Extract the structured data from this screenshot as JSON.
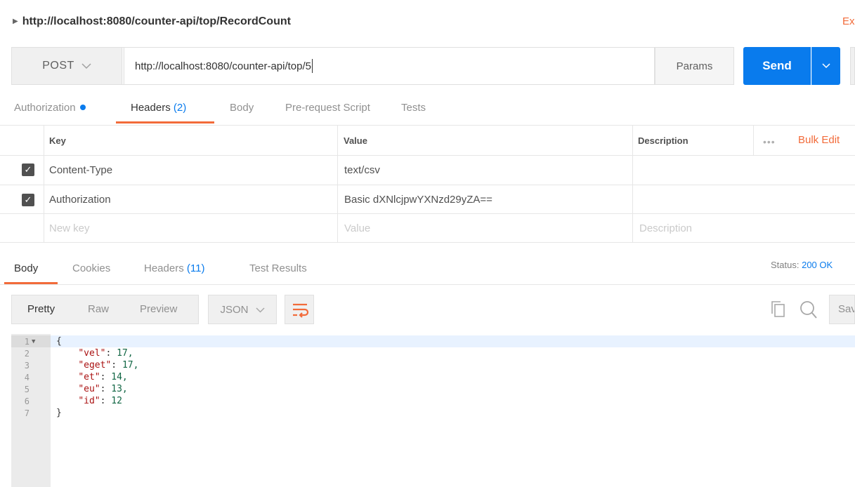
{
  "request": {
    "name": "http://localhost:8080/counter-api/top/RecordCount",
    "top_right_link": "Ex",
    "method": "POST",
    "url": "http://localhost:8080/counter-api/top/5",
    "params_label": "Params",
    "send_label": "Send",
    "extra_button": ""
  },
  "request_tabs": {
    "authorization": "Authorization",
    "headers": "Headers",
    "headers_count": "(2)",
    "body": "Body",
    "prerequest": "Pre-request Script",
    "tests": "Tests"
  },
  "headers_table": {
    "columns": {
      "key": "Key",
      "value": "Value",
      "description": "Description"
    },
    "bulk_edit": "Bulk Edit",
    "more": "•••",
    "rows": [
      {
        "key": "Content-Type",
        "value": "text/csv",
        "description": "",
        "checked": true
      },
      {
        "key": "Authorization",
        "value": "Basic dXNlcjpwYXNzd29yZA==",
        "description": "",
        "checked": true
      }
    ],
    "placeholders": {
      "key": "New key",
      "value": "Value",
      "description": "Description"
    }
  },
  "response": {
    "tabs": {
      "body": "Body",
      "cookies": "Cookies",
      "headers": "Headers",
      "headers_count": "(11)",
      "tests": "Test Results"
    },
    "status_label": "Status:",
    "status_value": "200 OK",
    "view_modes": {
      "pretty": "Pretty",
      "raw": "Raw",
      "preview": "Preview"
    },
    "format": "JSON",
    "save_label": "Save",
    "code_lines": [
      {
        "num": "1",
        "text": "{"
      },
      {
        "num": "2",
        "key": "\"vel\"",
        "val": "17,"
      },
      {
        "num": "3",
        "key": "\"eget\"",
        "val": "17,"
      },
      {
        "num": "4",
        "key": "\"et\"",
        "val": "14,"
      },
      {
        "num": "5",
        "key": "\"eu\"",
        "val": "13,"
      },
      {
        "num": "6",
        "key": "\"id\"",
        "val": "12"
      },
      {
        "num": "7",
        "text": "}"
      }
    ]
  },
  "colors": {
    "accent": "#097bed",
    "orange": "#f26b3a"
  },
  "icons": [
    "triangle-right-icon",
    "chevron-down-icon",
    "wrap-icon",
    "copy-icon",
    "search-icon",
    "checkbox-checked-icon"
  ]
}
